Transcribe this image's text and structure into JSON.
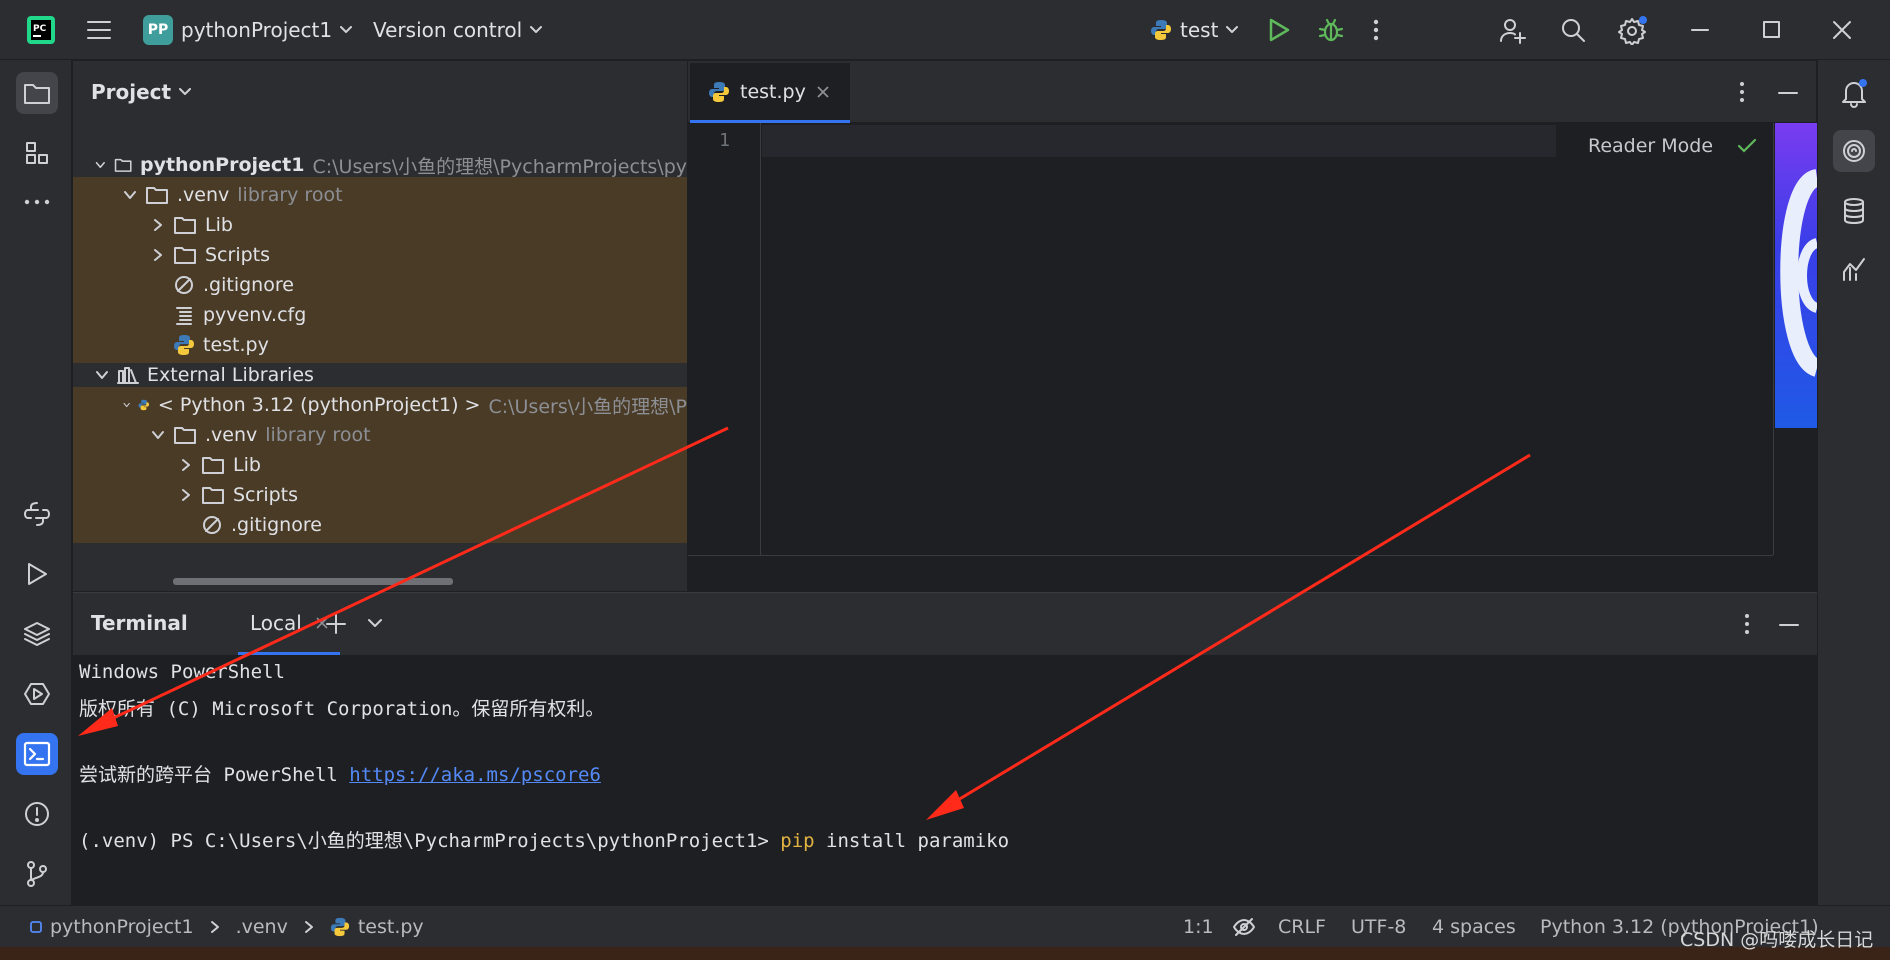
{
  "window": {
    "project_badge": "PP",
    "project_name": "pythonProject1",
    "menu_vcs": "Version control",
    "run_config": "test"
  },
  "project_panel": {
    "title": "Project",
    "rows": [
      {
        "label": "pythonProject1",
        "hint": "C:\\Users\\小鱼的理想\\PycharmProjects\\py"
      },
      {
        "label": ".venv",
        "hint": "library root"
      },
      {
        "label": "Lib"
      },
      {
        "label": "Scripts"
      },
      {
        "label": ".gitignore"
      },
      {
        "label": "pyvenv.cfg"
      },
      {
        "label": "test.py"
      },
      {
        "label": "External Libraries"
      },
      {
        "label": "< Python 3.12 (pythonProject1) >",
        "hint": "C:\\Users\\小鱼的理想\\P"
      },
      {
        "label": ".venv",
        "hint": "library root"
      },
      {
        "label": "Lib"
      },
      {
        "label": "Scripts"
      },
      {
        "label": ".gitignore"
      }
    ]
  },
  "editor": {
    "tab_label": "test.py",
    "line_number": "1",
    "reader_mode": "Reader Mode"
  },
  "terminal": {
    "title": "Terminal",
    "tab_local": "Local",
    "lines": {
      "l1": "Windows PowerShell",
      "l2": "版权所有 (C) Microsoft Corporation。保留所有权利。",
      "l3_prefix": "尝试新的跨平台 PowerShell ",
      "l3_link": "https://aka.ms/pscore6",
      "prompt": "(.venv) PS C:\\Users\\小鱼的理想\\PycharmProjects\\pythonProject1> ",
      "cmd_pip": "pip",
      "cmd_rest": " install paramiko"
    }
  },
  "statusbar": {
    "crumb_project": "pythonProject1",
    "crumb_venv": ".venv",
    "crumb_file": "test.py",
    "position": "1:1",
    "line_sep": "CRLF",
    "encoding": "UTF-8",
    "indent": "4 spaces",
    "interpreter": "Python 3.12 (pythonProject1)"
  },
  "watermark": "CSDN @吗喽成长日记",
  "colors": {
    "accent": "#3574f0",
    "library_bg": "#4a3b27",
    "arrow": "#ff2a1a",
    "run_green": "#5fb85b"
  },
  "icons": [
    "pycharm-logo-icon",
    "hamburger-menu-icon",
    "run-icon",
    "debug-icon",
    "more-vertical-icon",
    "add-user-icon",
    "search-icon",
    "settings-icon",
    "minimize-icon",
    "maximize-icon",
    "close-icon",
    "folder-icon",
    "structure-icon",
    "more-horizontal-icon",
    "python-console-icon",
    "services-run-icon",
    "layers-icon",
    "play-circle-icon",
    "terminal-icon",
    "problems-icon",
    "git-icon",
    "notifications-icon",
    "ai-assistant-icon",
    "database-icon",
    "sciview-icon"
  ]
}
